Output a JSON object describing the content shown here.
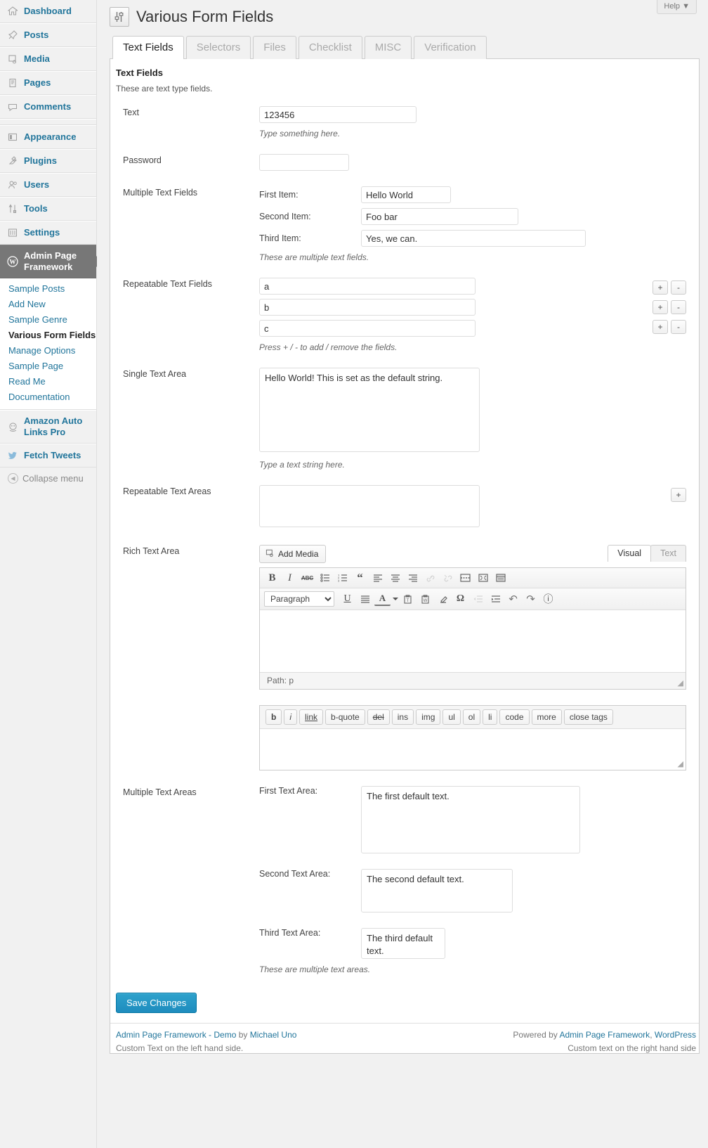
{
  "sidebar": {
    "items": [
      {
        "label": "Dashboard",
        "icon": "dashboard-icon"
      },
      {
        "label": "Posts",
        "icon": "pin-icon"
      },
      {
        "label": "Media",
        "icon": "media-icon"
      },
      {
        "label": "Pages",
        "icon": "pages-icon"
      },
      {
        "label": "Comments",
        "icon": "comment-icon"
      },
      {
        "label": "Appearance",
        "icon": "appearance-icon"
      },
      {
        "label": "Plugins",
        "icon": "plugin-icon"
      },
      {
        "label": "Users",
        "icon": "users-icon"
      },
      {
        "label": "Tools",
        "icon": "tools-icon"
      },
      {
        "label": "Settings",
        "icon": "settings-icon"
      }
    ],
    "current": {
      "label": "Admin Page Framework",
      "icon": "wordpress-icon"
    },
    "submenu": [
      {
        "label": "Sample Posts",
        "current": false
      },
      {
        "label": "Add New",
        "current": false
      },
      {
        "label": "Sample Genre",
        "current": false
      },
      {
        "label": "Various Form Fields",
        "current": true
      },
      {
        "label": "Manage Options",
        "current": false
      },
      {
        "label": "Sample Page",
        "current": false
      },
      {
        "label": "Read Me",
        "current": false
      },
      {
        "label": "Documentation",
        "current": false
      }
    ],
    "extra": [
      {
        "label": "Amazon Auto Links Pro",
        "icon": "amazon-icon"
      },
      {
        "label": "Fetch Tweets",
        "icon": "twitter-icon"
      }
    ],
    "collapse": {
      "label": "Collapse menu",
      "icon": "collapse-icon"
    }
  },
  "header": {
    "title": "Various Form Fields",
    "help_label": "Help",
    "help_caret": "▼",
    "icon": "sliders-icon"
  },
  "tabs": [
    {
      "label": "Text Fields",
      "active": true
    },
    {
      "label": "Selectors",
      "active": false
    },
    {
      "label": "Files",
      "active": false
    },
    {
      "label": "Checklist",
      "active": false
    },
    {
      "label": "MISC",
      "active": false
    },
    {
      "label": "Verification",
      "active": false
    }
  ],
  "section": {
    "heading": "Text Fields",
    "description": "These are text type fields."
  },
  "fields": {
    "text": {
      "label": "Text",
      "value": "123456",
      "hint": "Type something here."
    },
    "password": {
      "label": "Password",
      "value": ""
    },
    "multiple_text": {
      "label": "Multiple Text Fields",
      "items": [
        {
          "label": "First Item:",
          "value": "Hello World"
        },
        {
          "label": "Second Item:",
          "value": "Foo bar"
        },
        {
          "label": "Third Item:",
          "value": "Yes, we can."
        }
      ],
      "hint": "These are multiple text fields."
    },
    "repeatable_text": {
      "label": "Repeatable Text Fields",
      "values": [
        "a",
        "b",
        "c"
      ],
      "hint": "Press + / - to add / remove the fields.",
      "add_label": "+",
      "remove_label": "-"
    },
    "single_textarea": {
      "label": "Single Text Area",
      "value": "Hello World! This is set as the default string.",
      "hint": "Type a text string here."
    },
    "repeatable_textarea": {
      "label": "Repeatable Text Areas",
      "value": "",
      "add_label": "+"
    },
    "rich_textarea": {
      "label": "Rich Text Area",
      "add_media_label": "Add Media",
      "editor_tabs": [
        {
          "label": "Visual",
          "active": true
        },
        {
          "label": "Text",
          "active": false
        }
      ],
      "format_select": "Paragraph",
      "path_label": "Path: p",
      "toolbar_row1": [
        {
          "name": "bold-icon",
          "glyph": "B"
        },
        {
          "name": "italic-icon",
          "glyph": "I"
        },
        {
          "name": "strikethrough-icon",
          "glyph": "ABC"
        },
        {
          "name": "bullet-list-icon",
          "glyph": "☰"
        },
        {
          "name": "numbered-list-icon",
          "glyph": "☰"
        },
        {
          "name": "blockquote-icon",
          "glyph": "“"
        },
        {
          "name": "align-left-icon",
          "glyph": "≡"
        },
        {
          "name": "align-center-icon",
          "glyph": "≡"
        },
        {
          "name": "align-right-icon",
          "glyph": "≡"
        },
        {
          "name": "link-icon",
          "glyph": "⚭"
        },
        {
          "name": "unlink-icon",
          "glyph": "⚮"
        },
        {
          "name": "read-more-icon",
          "glyph": "▤"
        },
        {
          "name": "fullscreen-icon",
          "glyph": "⛶"
        },
        {
          "name": "kitchen-sink-icon",
          "glyph": "⌸"
        }
      ],
      "toolbar_row2": [
        {
          "name": "underline-icon",
          "glyph": "U"
        },
        {
          "name": "justify-icon",
          "glyph": "≡"
        },
        {
          "name": "text-color-icon",
          "glyph": "A"
        },
        {
          "name": "paste-text-icon",
          "glyph": "ὌB"
        },
        {
          "name": "paste-word-icon",
          "glyph": "ὌB"
        },
        {
          "name": "clear-formatting-icon",
          "glyph": "✐"
        },
        {
          "name": "special-char-icon",
          "glyph": "Ω"
        },
        {
          "name": "outdent-icon",
          "glyph": "⇤"
        },
        {
          "name": "indent-icon",
          "glyph": "⇥"
        },
        {
          "name": "undo-icon",
          "glyph": "↶"
        },
        {
          "name": "redo-icon",
          "glyph": "↷"
        },
        {
          "name": "help-icon",
          "glyph": "ⓘ"
        }
      ],
      "quicktags": [
        "b",
        "i",
        "link",
        "b-quote",
        "del",
        "ins",
        "img",
        "ul",
        "ol",
        "li",
        "code",
        "more",
        "close tags"
      ]
    },
    "multiple_textarea": {
      "label": "Multiple Text Areas",
      "items": [
        {
          "label": "First Text Area:",
          "value": "The first default text."
        },
        {
          "label": "Second Text Area:",
          "value": "The second default text."
        },
        {
          "label": "Third Text Area:",
          "value": "The third default text."
        }
      ],
      "hint": "These are multiple text areas."
    }
  },
  "submit": {
    "label": "Save Changes"
  },
  "footer": {
    "left_link": "Admin Page Framework - Demo",
    "left_by": " by ",
    "left_author": "Michael Uno",
    "left_custom": "Custom Text on the left hand side.",
    "right_prefix": "Powered by ",
    "right_link1": "Admin Page Framework",
    "right_sep": ", ",
    "right_link2": "WordPress",
    "right_custom": "Custom text on the right hand side"
  },
  "colors": {
    "accent": "#21759b",
    "button": "#2ea2cc",
    "sidebar_current": "#777777"
  }
}
